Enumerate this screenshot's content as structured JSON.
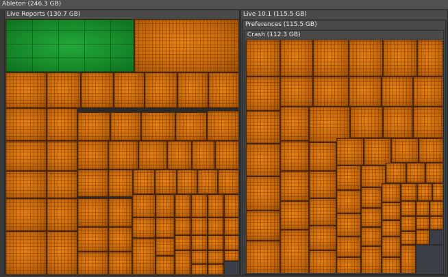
{
  "root": {
    "label": "Ableton (246.3 GB)"
  },
  "live_reports": {
    "label": "Live Reports (130.7 GB)"
  },
  "live_10_1": {
    "label": "Live 10.1 (115.5 GB)"
  },
  "preferences": {
    "label": "Preferences (115.5 GB)"
  },
  "crash": {
    "label": "Crash (112.3 GB)"
  },
  "colors": {
    "file_tile": "#d2720f",
    "large_file_tile": "#1c9a33",
    "small_files": "#3a3f47",
    "background": "#3c3c3c",
    "label_text": "#e8e8e8"
  }
}
